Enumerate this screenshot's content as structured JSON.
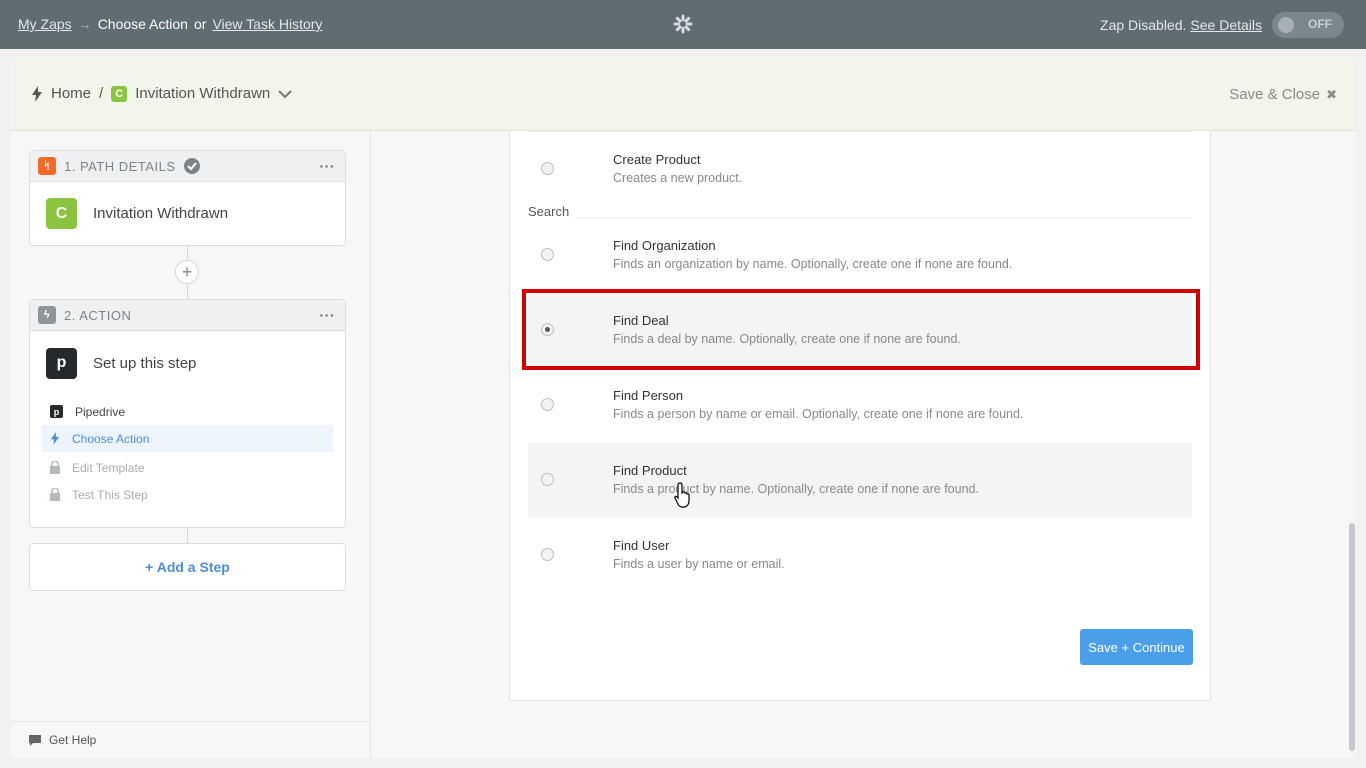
{
  "topbar": {
    "my_zaps": "My Zaps",
    "arrow": "→",
    "current": "Choose Action",
    "or": "or",
    "task_history": "View Task History",
    "status_text": "Zap Disabled.",
    "see_details": "See Details",
    "toggle_label": "OFF"
  },
  "editor_header": {
    "home": "Home",
    "separator": "/",
    "app_badge": "C",
    "zap_name": "Invitation Withdrawn",
    "save_close": "Save & Close",
    "close_glyph": "✖"
  },
  "sidebar": {
    "step1": {
      "label": "1. PATH DETAILS",
      "app_badge": "C",
      "app_name": "Invitation Withdrawn",
      "menu": "···"
    },
    "step2": {
      "label": "2. ACTION",
      "app_badge": "p",
      "app_name": "Set up this step",
      "menu": "···",
      "substeps": [
        {
          "label": "Pipedrive"
        },
        {
          "label": "Choose Action"
        },
        {
          "label": "Edit Template"
        },
        {
          "label": "Test This Step"
        }
      ]
    },
    "add_step": "+ Add a Step",
    "get_help": "Get Help"
  },
  "options": {
    "create_product": {
      "title": "Create Product",
      "desc": "Creates a new product."
    },
    "section": "Search",
    "find_organization": {
      "title": "Find Organization",
      "desc": "Finds an organization by name. Optionally, create one if none are found."
    },
    "find_deal": {
      "title": "Find Deal",
      "desc": "Finds a deal by name. Optionally, create one if none are found."
    },
    "find_person": {
      "title": "Find Person",
      "desc": "Finds a person by name or email. Optionally, create one if none are found."
    },
    "find_product": {
      "title": "Find Product",
      "desc": "Finds a product by name. Optionally, create one if none are found."
    },
    "find_user": {
      "title": "Find User",
      "desc": "Finds a user by name or email."
    }
  },
  "selected_option": "Find Deal",
  "save_continue": "Save + Continue",
  "colors": {
    "topbar": "#5f6c72",
    "accent": "#4a9fe8",
    "highlight": "#d40000",
    "path_orange": "#f26a2a",
    "c_green": "#8bc53f"
  }
}
